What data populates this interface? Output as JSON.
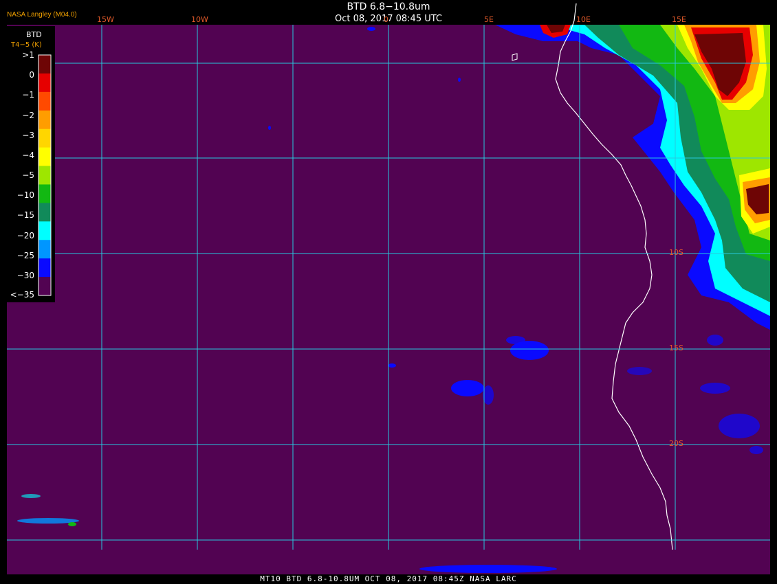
{
  "header": {
    "title": "BTD 6.8−10.8um",
    "datetime": "Oct 08, 2017 08:45 UTC",
    "credit": "NASA Langley (M04.0)"
  },
  "legend": {
    "title": "BTD",
    "units": "T4−5 (K)",
    "ticks": [
      ">1",
      "0",
      "−1",
      "−2",
      "−3",
      "−4",
      "−5",
      "−10",
      "−15",
      "−20",
      "−25",
      "−30",
      "<−35"
    ],
    "colors": [
      "#6e0505",
      "#e60000",
      "#ff4a00",
      "#ff9d00",
      "#ffd600",
      "#ffff00",
      "#9ee600",
      "#12b812",
      "#118a5a",
      "#00ffff",
      "#0096ff",
      "#0a0aff",
      "#520352"
    ]
  },
  "grid": {
    "lon_labels": [
      "15W",
      "10W",
      "0",
      "5E",
      "10E",
      "15E"
    ],
    "lat_labels": [
      "10S",
      "15S",
      "20S"
    ]
  },
  "footer": "MT10  BTD 6.8-10.8UM  OCT 08, 2017 08:45Z  NASA LARC",
  "colors": {
    "background": "#520352",
    "grid": "#27c9de",
    "coast": "#ffffff",
    "label": "#e35a2a"
  }
}
